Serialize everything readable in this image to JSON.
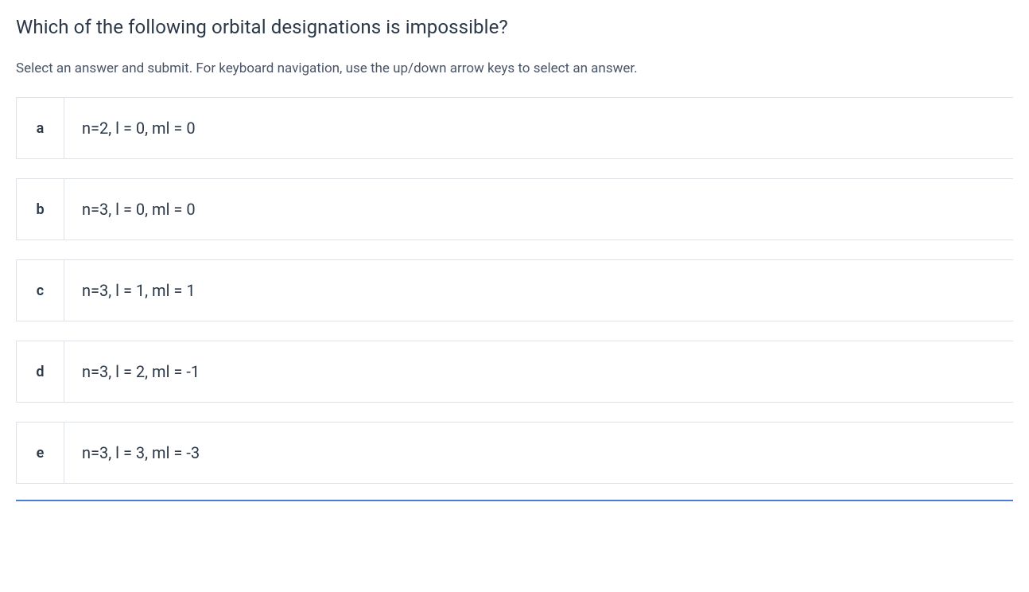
{
  "question": {
    "title": "Which of the following orbital designations is impossible?",
    "instructions": "Select an answer and submit. For keyboard navigation, use the up/down arrow keys to select an answer."
  },
  "options": [
    {
      "key": "a",
      "text": "n=2, l = 0, ml = 0"
    },
    {
      "key": "b",
      "text": "n=3, l = 0, ml = 0"
    },
    {
      "key": "c",
      "text": "n=3, l = 1, ml = 1"
    },
    {
      "key": "d",
      "text": "n=3, l = 2, ml = -1"
    },
    {
      "key": "e",
      "text": "n=3, l = 3, ml = -3"
    }
  ]
}
